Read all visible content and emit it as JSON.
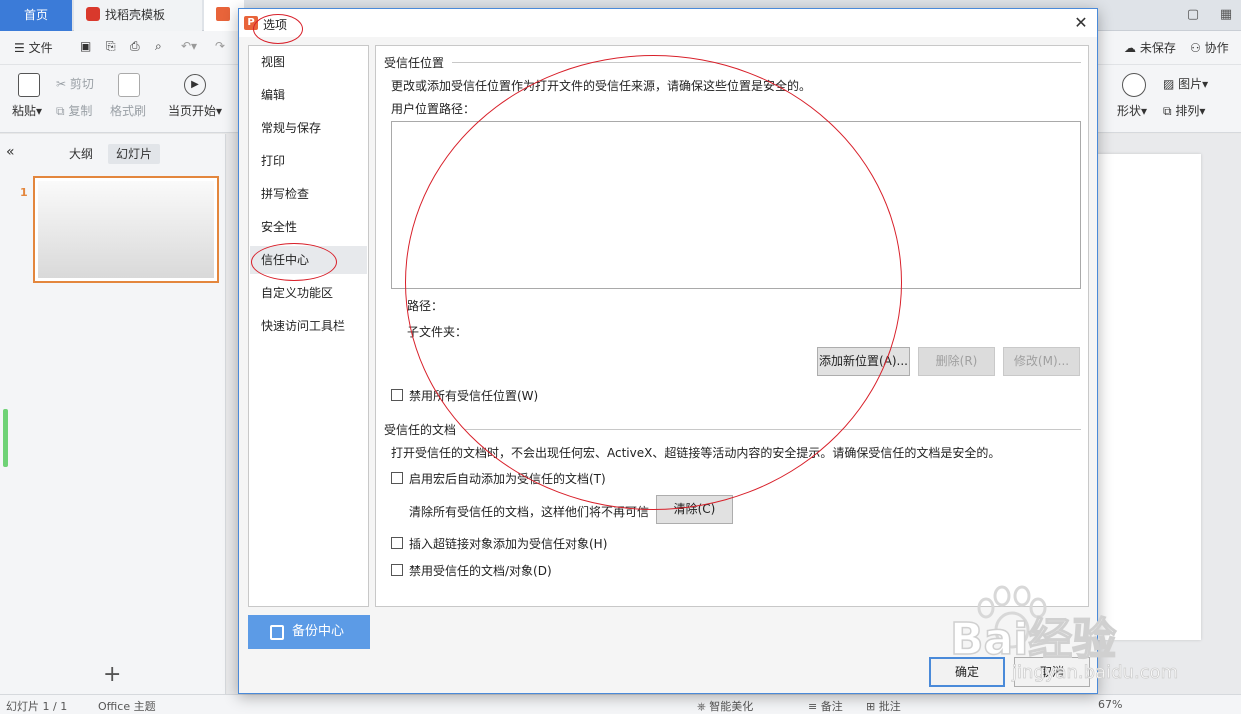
{
  "app": {
    "tabs": [
      {
        "label": "首页"
      },
      {
        "label": "找稻壳模板"
      }
    ],
    "menu": {
      "file": "文件",
      "unsaved": "未保存",
      "collab": "协作"
    },
    "ribbon": {
      "paste": "粘贴",
      "cut": "剪切",
      "copy": "复制",
      "format_painter": "格式刷",
      "from_current": "当页开始",
      "picture": "图片",
      "shape": "形状",
      "arrange": "排列"
    },
    "left_panel": {
      "outline_tab": "大纲",
      "slides_tab": "幻灯片",
      "slide_number": "1"
    },
    "status": {
      "slide_info": "幻灯片 1 / 1",
      "theme": "Office 主题",
      "beautify": "智能美化",
      "notes": "备注",
      "comments": "批注",
      "zoom": "67%"
    }
  },
  "dialog": {
    "title": "选项",
    "nav": [
      {
        "label": "视图"
      },
      {
        "label": "编辑"
      },
      {
        "label": "常规与保存"
      },
      {
        "label": "打印"
      },
      {
        "label": "拼写检查"
      },
      {
        "label": "安全性"
      },
      {
        "label": "信任中心"
      },
      {
        "label": "自定义功能区"
      },
      {
        "label": "快速访问工具栏"
      }
    ],
    "active_nav": "信任中心",
    "backup_center": "备份中心",
    "trusted_locations": {
      "title": "受信任位置",
      "description": "更改或添加受信任位置作为打开文件的受信任来源，请确保这些位置是安全的。",
      "user_path_label": "用户位置路径：",
      "path_label": "路径：",
      "subfolder_label": "子文件夹：",
      "add_button": "添加新位置(A)...",
      "delete_button": "删除(R)",
      "modify_button": "修改(M)...",
      "disable_all": "禁用所有受信任位置(W)"
    },
    "trusted_documents": {
      "title": "受信任的文档",
      "description": "打开受信任的文档时，不会出现任何宏、ActiveX、超链接等活动内容的安全提示。请确保受信任的文档是安全的。",
      "auto_add": "启用宏后自动添加为受信任的文档(T)",
      "clear_text": "清除所有受信任的文档，这样他们将不再可信",
      "clear_button": "清除(C)",
      "hyperlink_trust": "插入超链接对象添加为受信任对象(H)",
      "disable_docs": "禁用受信任的文档/对象(D)"
    },
    "ok": "确定",
    "cancel": "取消"
  },
  "watermark": {
    "text": "Bai经验",
    "url": "jingyan.baidu.com"
  }
}
